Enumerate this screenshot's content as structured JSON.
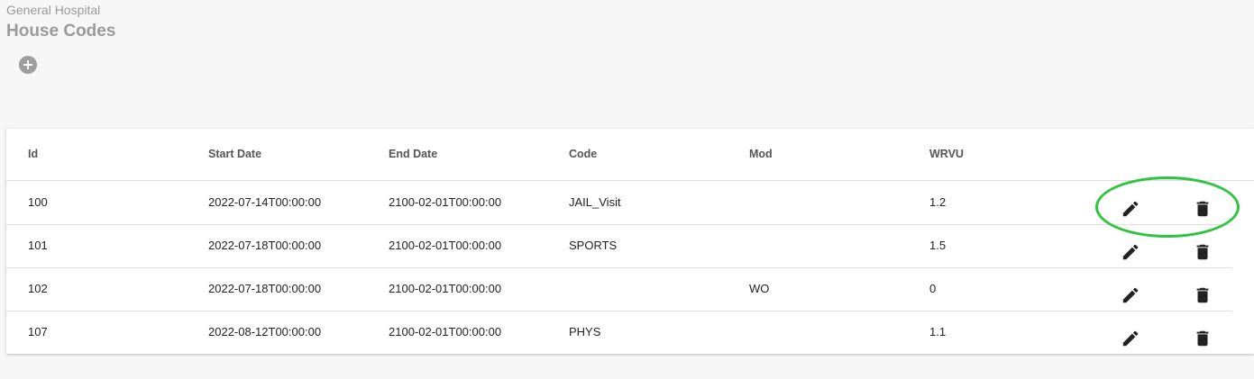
{
  "header": {
    "org": "General Hospital",
    "title": "House Codes"
  },
  "toolbar": {
    "add_icon": "plus-circle-icon"
  },
  "table": {
    "columns": [
      "Id",
      "Start Date",
      "End Date",
      "Code",
      "Mod",
      "WRVU"
    ],
    "rows": [
      {
        "id": "100",
        "start": "2022-07-14T00:00:00",
        "end": "2100-02-01T00:00:00",
        "code": "JAIL_Visit",
        "mod": "",
        "wrvu": "1.2"
      },
      {
        "id": "101",
        "start": "2022-07-18T00:00:00",
        "end": "2100-02-01T00:00:00",
        "code": "SPORTS",
        "mod": "",
        "wrvu": "1.5"
      },
      {
        "id": "102",
        "start": "2022-07-18T00:00:00",
        "end": "2100-02-01T00:00:00",
        "code": "",
        "mod": "WO",
        "wrvu": "0"
      },
      {
        "id": "107",
        "start": "2022-08-12T00:00:00",
        "end": "2100-02-01T00:00:00",
        "code": "PHYS",
        "mod": "",
        "wrvu": "1.1"
      }
    ],
    "row_action_icons": [
      "pencil-icon",
      "trash-icon"
    ]
  },
  "annotation": {
    "color": "#2fc43f"
  }
}
